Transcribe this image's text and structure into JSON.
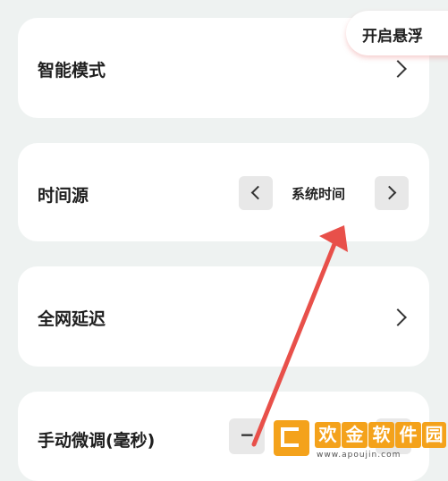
{
  "float_button": {
    "label": "开启悬浮"
  },
  "rows": {
    "smart_mode": {
      "label": "智能模式"
    },
    "time_source": {
      "label": "时间源",
      "value": "系统时间"
    },
    "network_delay": {
      "label": "全网延迟"
    },
    "manual_adjust": {
      "label": "手动微调(毫秒)",
      "minus": "−"
    }
  },
  "watermark": {
    "chars": [
      "欢",
      "金",
      "软",
      "件",
      "园"
    ],
    "url": "www.apoujin.com"
  },
  "annotation": {
    "arrow_color": "#e8504a"
  }
}
